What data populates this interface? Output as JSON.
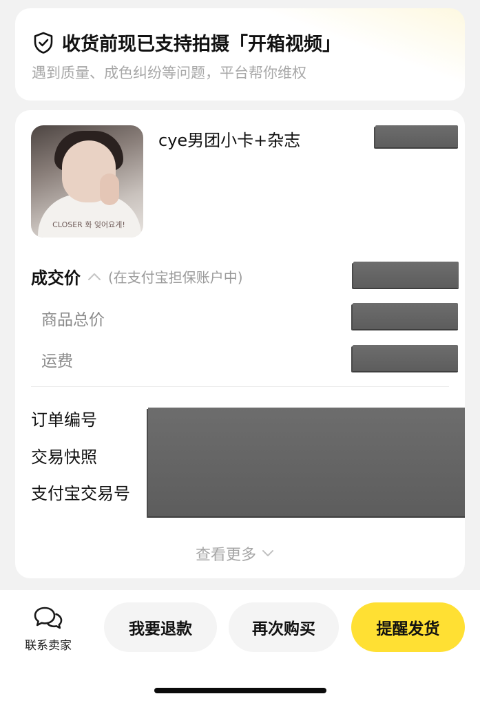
{
  "notice": {
    "title": "收货前现已支持拍摄「开箱视频」",
    "subtitle": "遇到质量、成色纠纷等问题，平台帮你维权",
    "icon": "shield-check-icon"
  },
  "product": {
    "title": "cye男团小卡+杂志",
    "thumbnail_caption": "CLOSER 화 잊어요게!"
  },
  "pricing": {
    "deal_price_label": "成交价",
    "deal_price_note": "(在支付宝担保账户中)",
    "subtotal_label": "商品总价",
    "shipping_label": "运费"
  },
  "order_info": {
    "order_no_label": "订单编号",
    "snapshot_label": "交易快照",
    "alipay_no_label": "支付宝交易号"
  },
  "view_more": "查看更多",
  "actions": {
    "contact_seller": "联系卖家",
    "refund": "我要退款",
    "rebuy": "再次购买",
    "remind_ship": "提醒发货"
  },
  "colors": {
    "accent": "#ffe033",
    "background": "#f2f2f2",
    "redaction": "#636363"
  }
}
